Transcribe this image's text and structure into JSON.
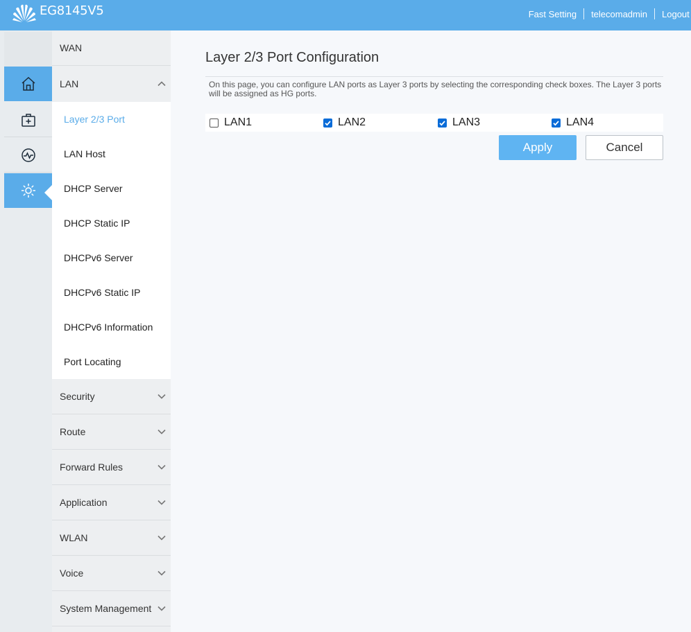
{
  "header": {
    "model": "EG8145V5",
    "fast_setting": "Fast Setting",
    "user": "telecomadmin",
    "logout": "Logout"
  },
  "rail": {
    "icons": [
      "home-icon",
      "medical-box-icon",
      "diagnosis-icon",
      "settings-gear-icon"
    ],
    "active": "settings-gear-icon"
  },
  "menu": {
    "wan": "WAN",
    "lan": "LAN",
    "lan_items": [
      "Layer 2/3 Port",
      "LAN Host",
      "DHCP Server",
      "DHCP Static IP",
      "DHCPv6 Server",
      "DHCPv6 Static IP",
      "DHCPv6 Information",
      "Port Locating"
    ],
    "active_item": "Layer 2/3 Port",
    "groups": [
      "Security",
      "Route",
      "Forward Rules",
      "Application",
      "WLAN",
      "Voice",
      "System Management"
    ]
  },
  "page": {
    "title": "Layer 2/3 Port Configuration",
    "description": "On this page, you can configure LAN ports as Layer 3 ports by selecting the corresponding check boxes. The Layer 3 ports will be assigned as HG ports.",
    "ports": [
      {
        "label": "LAN1",
        "checked": false
      },
      {
        "label": "LAN2",
        "checked": true
      },
      {
        "label": "LAN3",
        "checked": true
      },
      {
        "label": "LAN4",
        "checked": true
      }
    ],
    "apply": "Apply",
    "cancel": "Cancel"
  },
  "colors": {
    "accent": "#5aace9",
    "checkbox": "#0a6cd8"
  }
}
